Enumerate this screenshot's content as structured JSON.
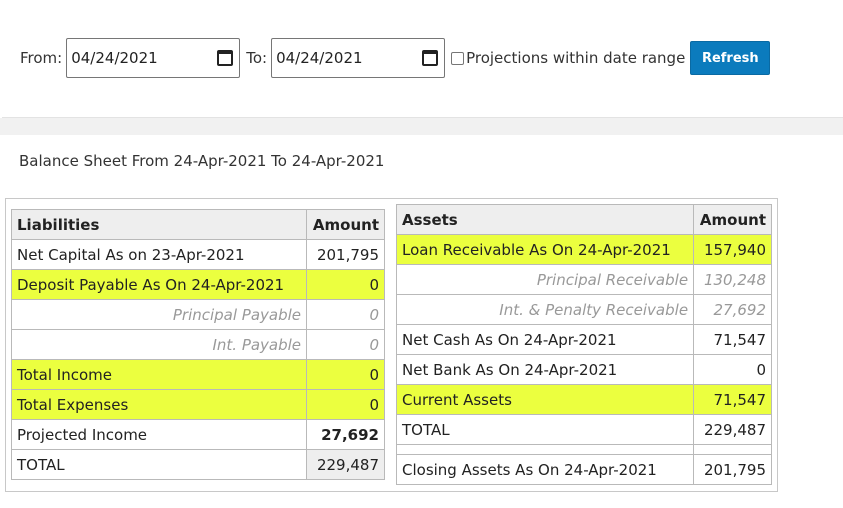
{
  "filter": {
    "from_label": "From:",
    "from_value": "04/24/2021",
    "to_label": "To:",
    "to_value": "04/24/2021",
    "projection_label": "Projections within date range",
    "refresh_label": "Refresh"
  },
  "sheet_title": "Balance Sheet From 24-Apr-2021 To 24-Apr-2021",
  "liabilities": {
    "header_label": "Liabilities",
    "header_amount": "Amount",
    "rows": [
      {
        "label": "Net Capital As on 23-Apr-2021",
        "amount": "201,795"
      },
      {
        "label": "Deposit Payable As On 24-Apr-2021",
        "amount": "0"
      },
      {
        "label": "Principal Payable",
        "amount": "0"
      },
      {
        "label": "Int. Payable",
        "amount": "0"
      },
      {
        "label": "Total Income",
        "amount": "0"
      },
      {
        "label": "Total Expenses",
        "amount": "0"
      },
      {
        "label": "Projected Income",
        "amount": "27,692"
      },
      {
        "label": "TOTAL",
        "amount": "229,487"
      }
    ]
  },
  "assets": {
    "header_label": "Assets",
    "header_amount": "Amount",
    "rows": [
      {
        "label": "Loan Receivable As On 24-Apr-2021",
        "amount": "157,940"
      },
      {
        "label": "Principal Receivable",
        "amount": "130,248"
      },
      {
        "label": "Int. & Penalty Receivable",
        "amount": "27,692"
      },
      {
        "label": "Net Cash As On 24-Apr-2021",
        "amount": "71,547"
      },
      {
        "label": "Net Bank As On 24-Apr-2021",
        "amount": "0"
      },
      {
        "label": "Current Assets",
        "amount": "71,547"
      },
      {
        "label": "TOTAL",
        "amount": "229,487"
      },
      {
        "label": "Closing Assets As On 24-Apr-2021",
        "amount": "201,795"
      }
    ]
  },
  "colors": {
    "highlight": "#ebff3f",
    "button": "#0b7bbd"
  }
}
